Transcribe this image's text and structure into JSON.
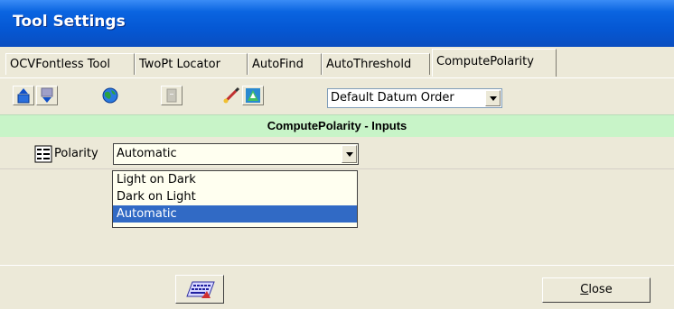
{
  "window": {
    "title": "Tool Settings"
  },
  "tabs": [
    {
      "label": "OCVFontless Tool",
      "active": false
    },
    {
      "label": "TwoPt Locator",
      "active": false
    },
    {
      "label": "AutoFind",
      "active": false
    },
    {
      "label": "AutoThreshold",
      "active": false
    },
    {
      "label": "ComputePolarity",
      "active": true
    }
  ],
  "toolbar": {
    "icons": [
      "move-up-icon",
      "move-down-icon",
      "globe-icon",
      "disabled-icon",
      "paint-brush-icon",
      "datum-icon"
    ],
    "datum_select": {
      "value": "Default Datum Order"
    }
  },
  "section": {
    "header": "ComputePolarity - Inputs"
  },
  "polarity": {
    "label": "Polarity",
    "value": "Automatic",
    "options": [
      "Light on Dark",
      "Dark on Light",
      "Automatic"
    ],
    "selected": "Automatic"
  },
  "footer": {
    "keyboard_icon": "keyboard-icon",
    "close_label_first": "C",
    "close_label_rest": "lose"
  },
  "colors": {
    "title_bar": "#0558d4",
    "header_bg": "#c8f4c8",
    "selection": "#316ac5",
    "dropdown_bg": "#fffff0"
  }
}
